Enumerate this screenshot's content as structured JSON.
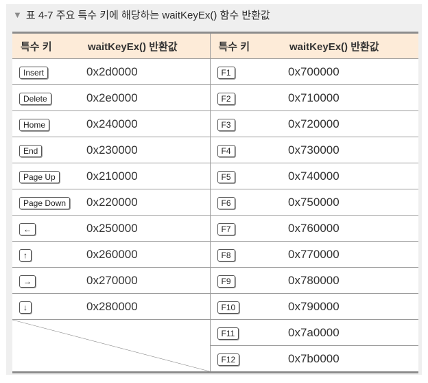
{
  "caption": {
    "icon": "chevron-down-icon",
    "text": "표 4-7 주요 특수 키에 해당하는 waitKeyEx() 함수 반환값"
  },
  "headers": [
    "특수 키",
    "waitKeyEx() 반환값",
    "특수 키",
    "waitKeyEx() 반환값"
  ],
  "left_rows": [
    {
      "key": "Insert",
      "value": "0x2d0000"
    },
    {
      "key": "Delete",
      "value": "0x2e0000"
    },
    {
      "key": "Home",
      "value": "0x240000"
    },
    {
      "key": "End",
      "value": "0x230000"
    },
    {
      "key": "Page Up",
      "value": "0x210000"
    },
    {
      "key": "Page Down",
      "value": "0x220000"
    },
    {
      "key": "←",
      "value": "0x250000"
    },
    {
      "key": "↑",
      "value": "0x260000"
    },
    {
      "key": "→",
      "value": "0x270000"
    },
    {
      "key": "↓",
      "value": "0x280000"
    }
  ],
  "right_rows": [
    {
      "key": "F1",
      "value": "0x700000"
    },
    {
      "key": "F2",
      "value": "0x710000"
    },
    {
      "key": "F3",
      "value": "0x720000"
    },
    {
      "key": "F4",
      "value": "0x730000"
    },
    {
      "key": "F5",
      "value": "0x740000"
    },
    {
      "key": "F6",
      "value": "0x750000"
    },
    {
      "key": "F7",
      "value": "0x760000"
    },
    {
      "key": "F8",
      "value": "0x770000"
    },
    {
      "key": "F9",
      "value": "0x780000"
    },
    {
      "key": "F10",
      "value": "0x790000"
    },
    {
      "key": "F11",
      "value": "0x7a0000"
    },
    {
      "key": "F12",
      "value": "0x7b0000"
    }
  ]
}
